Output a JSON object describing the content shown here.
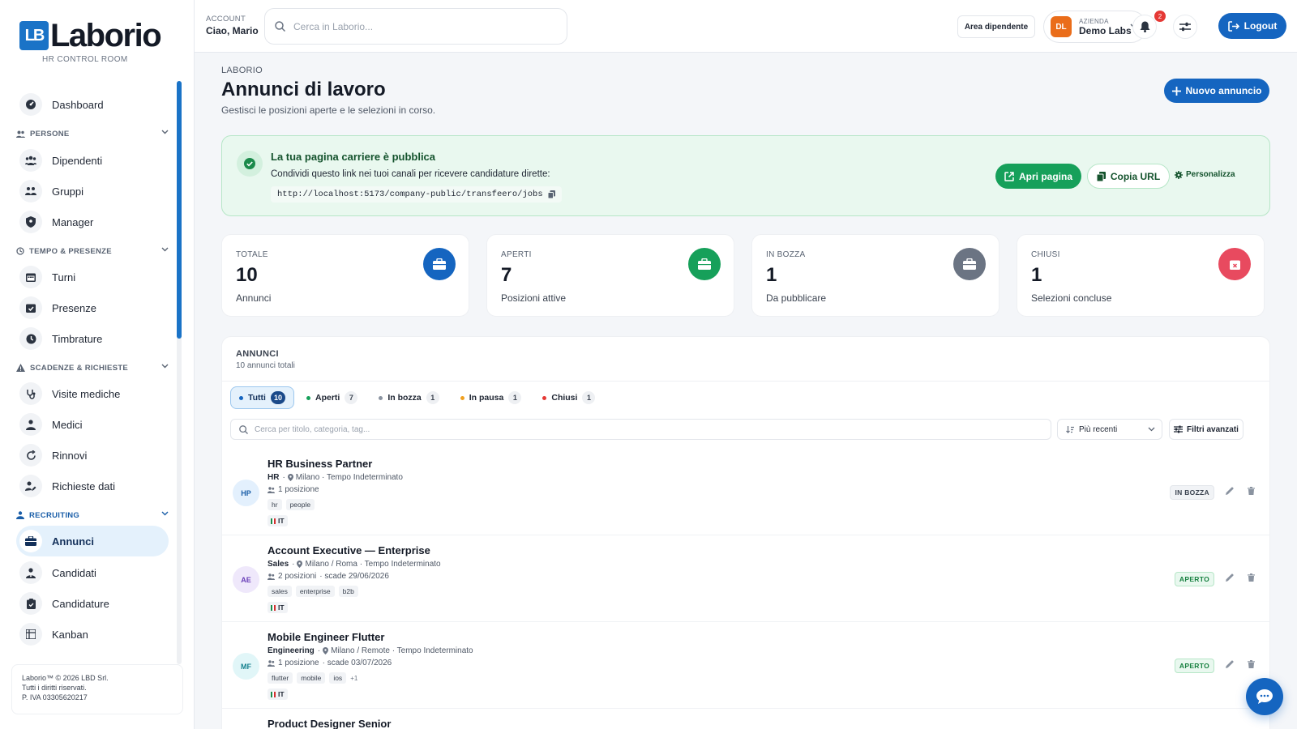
{
  "brand": {
    "mark": "LB",
    "name": "Laborio",
    "subtitle": "HR CONTROL ROOM"
  },
  "sidebar": {
    "dashboard": "Dashboard",
    "sections": [
      {
        "label": "PERSONE",
        "items": [
          "Dipendenti",
          "Gruppi",
          "Manager"
        ]
      },
      {
        "label": "TEMPO & PRESENZE",
        "items": [
          "Turni",
          "Presenze",
          "Timbrature"
        ]
      },
      {
        "label": "SCADENZE & RICHIESTE",
        "items": [
          "Visite mediche",
          "Medici",
          "Rinnovi",
          "Richieste dati"
        ]
      },
      {
        "label": "RECRUITING",
        "items": [
          "Annunci",
          "Candidati",
          "Candidature",
          "Kanban"
        ]
      }
    ],
    "active": "Annunci",
    "footer": {
      "line1": "Laborio™ © 2026 LBD Srl.",
      "line2": "Tutti i diritti riservati.",
      "line3": "P. IVA 03305620217"
    }
  },
  "topbar": {
    "account_label": "ACCOUNT",
    "account_name": "Ciao, Mario",
    "search_placeholder": "Cerca in Laborio...",
    "area_button": "Area dipendente",
    "company_label": "AZIENDA",
    "company_name": "Demo Labs",
    "company_initials": "DL",
    "notifications": "2",
    "logout": "Logout"
  },
  "page": {
    "breadcrumb": "LABORIO",
    "title": "Annunci di lavoro",
    "subtitle": "Gestisci le posizioni aperte e le selezioni in corso.",
    "new_button": "Nuovo annuncio"
  },
  "career": {
    "title": "La tua pagina carriere è pubblica",
    "desc": "Condividi questo link nei tuoi canali per ricevere candidature dirette:",
    "url": "http://localhost:5173/company-public/transfeero/jobs",
    "open": "Apri pagina",
    "copy": "Copia URL",
    "customize": "Personalizza"
  },
  "stats": [
    {
      "label": "TOTALE",
      "value": "10",
      "sub": "Annunci",
      "color": "#1565c0"
    },
    {
      "label": "APERTI",
      "value": "7",
      "sub": "Posizioni attive",
      "color": "#16a05a"
    },
    {
      "label": "IN BOZZA",
      "value": "1",
      "sub": "Da pubblicare",
      "color": "#6b7483"
    },
    {
      "label": "CHIUSI",
      "value": "1",
      "sub": "Selezioni concluse",
      "color": "#e84a5f"
    }
  ],
  "list": {
    "title": "ANNUNCI",
    "count": "10 annunci totali",
    "filters": [
      {
        "label": "Tutti",
        "count": "10",
        "color": "#1565c0"
      },
      {
        "label": "Aperti",
        "count": "7",
        "color": "#16a05a"
      },
      {
        "label": "In bozza",
        "count": "1",
        "color": "#8a93a0"
      },
      {
        "label": "In pausa",
        "count": "1",
        "color": "#f0a020"
      },
      {
        "label": "Chiusi",
        "count": "1",
        "color": "#e53935"
      }
    ],
    "search_placeholder": "Cerca per titolo, categoria, tag...",
    "sort": "Più recenti",
    "advanced": "Filtri avanzati",
    "jobs": [
      {
        "initials": "HP",
        "title": "HR Business Partner",
        "dept": "HR",
        "location": "Milano · Tempo Indeterminato",
        "positions": "1 posizione",
        "deadline": "",
        "tags": [
          "hr",
          "people"
        ],
        "more": "",
        "lang": "IT",
        "status": "IN BOZZA",
        "avatar_bg": "#e3f0fd",
        "avatar_fg": "#1a5ea8"
      },
      {
        "initials": "AE",
        "title": "Account Executive — Enterprise",
        "dept": "Sales",
        "location": "Milano / Roma · Tempo Indeterminato",
        "positions": "2 posizioni",
        "deadline": "· scade 29/06/2026",
        "tags": [
          "sales",
          "enterprise",
          "b2b"
        ],
        "more": "",
        "lang": "IT",
        "status": "APERTO",
        "avatar_bg": "#efe8fb",
        "avatar_fg": "#6a3fb8"
      },
      {
        "initials": "MF",
        "title": "Mobile Engineer Flutter",
        "dept": "Engineering",
        "location": "Milano / Remote · Tempo Indeterminato",
        "positions": "1 posizione",
        "deadline": "· scade 03/07/2026",
        "tags": [
          "flutter",
          "mobile",
          "ios"
        ],
        "more": "+1",
        "lang": "IT",
        "status": "APERTO",
        "avatar_bg": "#e1f6f8",
        "avatar_fg": "#16828f"
      },
      {
        "title": "Product Designer Senior"
      }
    ]
  }
}
